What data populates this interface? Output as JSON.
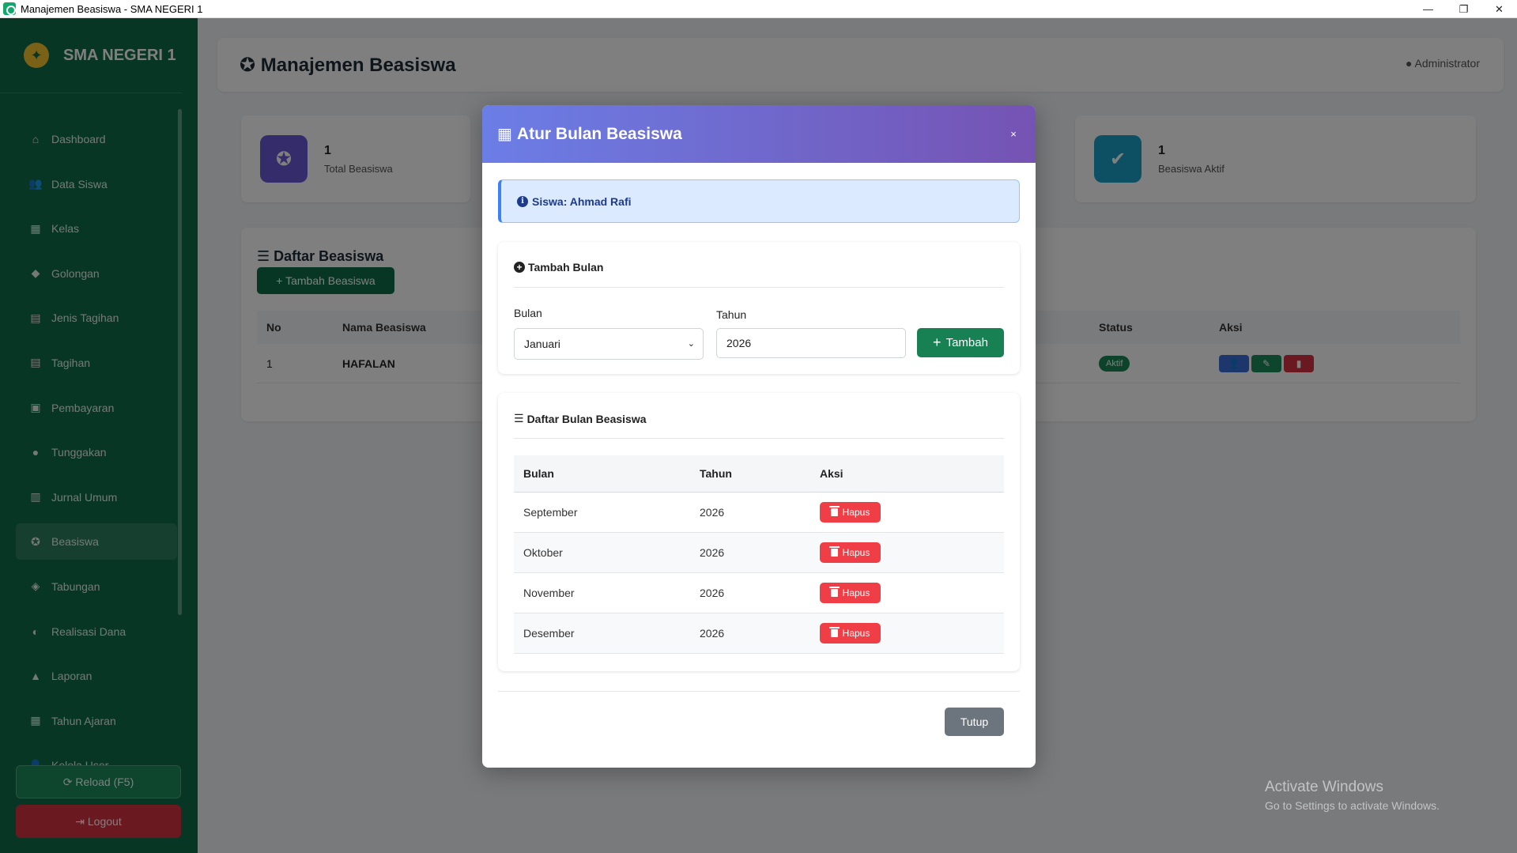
{
  "window": {
    "title": "Manajemen Beasiswa - SMA NEGERI 1",
    "minimize": "—",
    "maximize": "❐",
    "close": "✕"
  },
  "sidebar": {
    "brand": "SMA NEGERI 1",
    "items": [
      {
        "label": "Dashboard",
        "icon": "⌂"
      },
      {
        "label": "Data Siswa",
        "icon": "👥"
      },
      {
        "label": "Kelas",
        "icon": "▦"
      },
      {
        "label": "Golongan",
        "icon": "◆"
      },
      {
        "label": "Jenis Tagihan",
        "icon": "▤"
      },
      {
        "label": "Tagihan",
        "icon": "▤"
      },
      {
        "label": "Pembayaran",
        "icon": "▣"
      },
      {
        "label": "Tunggakan",
        "icon": "●"
      },
      {
        "label": "Jurnal Umum",
        "icon": "▥"
      },
      {
        "label": "Beasiswa",
        "icon": "✪"
      },
      {
        "label": "Tabungan",
        "icon": "◈"
      },
      {
        "label": "Realisasi Dana",
        "icon": "◐"
      },
      {
        "label": "Laporan",
        "icon": "▲"
      },
      {
        "label": "Tahun Ajaran",
        "icon": "▦"
      },
      {
        "label": "Kelola User",
        "icon": "👤"
      }
    ],
    "reload": "⟳ Reload (F5)",
    "logout": "⇥ Logout"
  },
  "header": {
    "title": "✪ Manajemen Beasiswa",
    "user": "Administrator"
  },
  "stats": [
    {
      "value": "1",
      "label": "Total Beasiswa",
      "color": "#6b5bd6"
    },
    {
      "value": "1",
      "label": "Beasiswa Aktif",
      "color": "#1aa0c8"
    }
  ],
  "list": {
    "title": "☰ Daftar Beasiswa",
    "add_button": "+ Tambah Beasiswa",
    "columns": {
      "no": "No",
      "nama": "Nama Beasiswa",
      "status": "Status",
      "aksi": "Aksi"
    },
    "rows": [
      {
        "no": "1",
        "nama": "HAFALAN",
        "status": "Aktif"
      }
    ]
  },
  "modal": {
    "title": "Atur Bulan Beasiswa",
    "close": "×",
    "student_info": "Siswa: Ahmad Rafi",
    "add_section": {
      "title": "Tambah Bulan",
      "month_label": "Bulan",
      "month_value": "Januari",
      "year_label": "Tahun",
      "year_value": "2026",
      "add_button": "Tambah"
    },
    "list_section": {
      "title": "Daftar Bulan Beasiswa",
      "columns": {
        "bulan": "Bulan",
        "tahun": "Tahun",
        "aksi": "Aksi"
      },
      "delete_label": "Hapus",
      "rows": [
        {
          "bulan": "September",
          "tahun": "2026"
        },
        {
          "bulan": "Oktober",
          "tahun": "2026"
        },
        {
          "bulan": "November",
          "tahun": "2026"
        },
        {
          "bulan": "Desember",
          "tahun": "2026"
        }
      ]
    },
    "close_button": "Tutup"
  },
  "watermark": {
    "title": "Activate Windows",
    "subtitle": "Go to Settings to activate Windows."
  },
  "colors": {
    "sidebar": "#0f6e48",
    "modal_gradient_start": "#6b7ee6",
    "modal_gradient_end": "#7553b3",
    "danger": "#ef3e45",
    "success": "#178153"
  }
}
